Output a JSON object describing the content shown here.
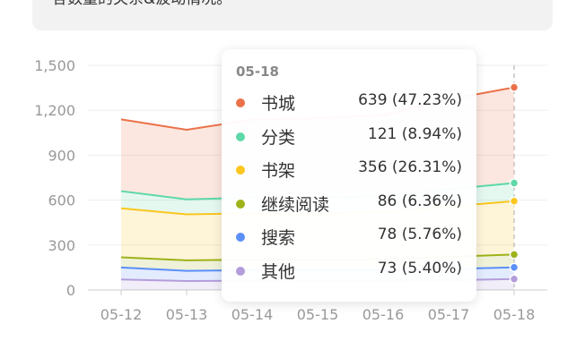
{
  "header": {
    "description_fragment": "各数量的关系&波动情况。"
  },
  "chart_data": {
    "type": "area",
    "stacked": true,
    "categories": [
      "05-12",
      "05-13",
      "05-14",
      "05-15",
      "05-16",
      "05-17",
      "05-18"
    ],
    "ylim": [
      0,
      1500
    ],
    "yticks": [
      "1,500",
      "1,200",
      "900",
      "600",
      "300",
      "0"
    ],
    "ytick_values": [
      1500,
      1200,
      900,
      600,
      300,
      0
    ],
    "grid": true,
    "series": [
      {
        "name": "其他",
        "color": "#b39ddb",
        "values": [
          70,
          60,
          62,
          62,
          62,
          65,
          73
        ]
      },
      {
        "name": "搜索",
        "color": "#5b8ff9",
        "values": [
          80,
          68,
          70,
          70,
          70,
          75,
          78
        ]
      },
      {
        "name": "继续阅读",
        "color": "#9eb21a",
        "values": [
          68,
          70,
          70,
          70,
          72,
          82,
          86
        ]
      },
      {
        "name": "书架",
        "color": "#fac61f",
        "values": [
          327,
          307,
          310,
          310,
          315,
          335,
          356
        ]
      },
      {
        "name": "分类",
        "color": "#5ed8a8",
        "values": [
          115,
          100,
          105,
          105,
          108,
          115,
          121
        ]
      },
      {
        "name": "书城",
        "color": "#eb7149",
        "values": [
          479,
          465,
          520,
          530,
          540,
          600,
          639
        ]
      }
    ]
  },
  "tooltip": {
    "date": "05-18",
    "rows": [
      {
        "label": "书城",
        "value": "639 (47.23%)",
        "color": "#eb7149"
      },
      {
        "label": "分类",
        "value": "121 (8.94%)",
        "color": "#5ed8a8"
      },
      {
        "label": "书架",
        "value": "356 (26.31%)",
        "color": "#fac61f"
      },
      {
        "label": "继续阅读",
        "value": "86 (6.36%)",
        "color": "#9eb21a"
      },
      {
        "label": "搜索",
        "value": "78 (5.76%)",
        "color": "#5b8ff9"
      },
      {
        "label": "其他",
        "value": "73 (5.40%)",
        "color": "#b39ddb"
      }
    ]
  }
}
